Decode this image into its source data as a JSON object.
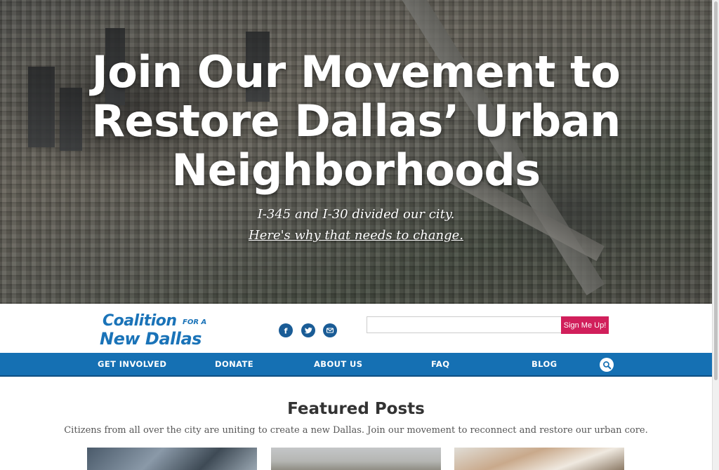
{
  "hero": {
    "headline": "Join Our Movement to Restore Dallas’ Urban Neighborhoods",
    "subline": "I-345 and I-30 divided our city.",
    "link_text": "Here's why that needs to change."
  },
  "header": {
    "logo": {
      "line1": "Coalition",
      "line1_small": "FOR A",
      "line2": "New Dallas"
    },
    "social": [
      {
        "name": "facebook-icon",
        "glyph": "f"
      },
      {
        "name": "twitter-icon",
        "glyph": "twitter"
      },
      {
        "name": "email-icon",
        "glyph": "envelope"
      }
    ],
    "signup": {
      "input_value": "",
      "placeholder": "",
      "button_label": "Sign Me Up!"
    }
  },
  "nav": {
    "items": [
      {
        "label": "GET INVOLVED"
      },
      {
        "label": "DONATE"
      },
      {
        "label": "ABOUT US"
      },
      {
        "label": "FAQ"
      },
      {
        "label": "BLOG"
      }
    ],
    "search_icon": "search-icon"
  },
  "featured": {
    "title": "Featured Posts",
    "description": "Citizens from all over the city are uniting to create a new Dallas. Join our movement to reconnect and restore our urban core."
  },
  "colors": {
    "brand_blue": "#1a73b8",
    "nav_blue": "#1570b3",
    "social_blue": "#1a5c96",
    "signup_pink": "#d11f5b"
  }
}
